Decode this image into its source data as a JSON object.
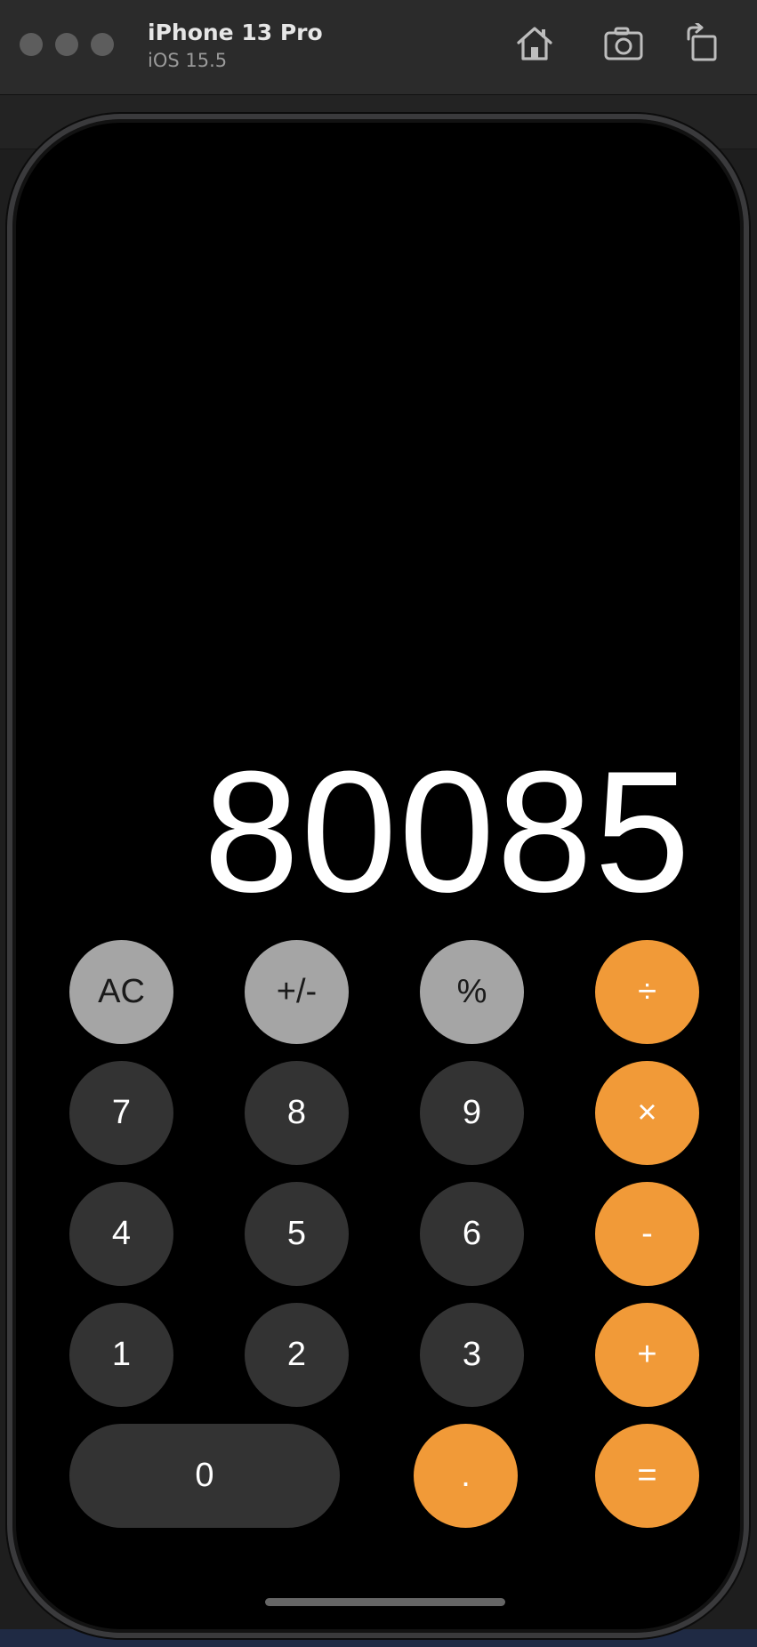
{
  "simulator": {
    "device_name": "iPhone 13 Pro",
    "os_version": "iOS 15.5"
  },
  "calculator": {
    "display": "80085",
    "rows": [
      [
        {
          "label": "AC",
          "style": "light"
        },
        {
          "label": "+/-",
          "style": "light"
        },
        {
          "label": "%",
          "style": "light"
        },
        {
          "label": "÷",
          "style": "orange"
        }
      ],
      [
        {
          "label": "7",
          "style": "dark"
        },
        {
          "label": "8",
          "style": "dark"
        },
        {
          "label": "9",
          "style": "dark"
        },
        {
          "label": "×",
          "style": "orange"
        }
      ],
      [
        {
          "label": "4",
          "style": "dark"
        },
        {
          "label": "5",
          "style": "dark"
        },
        {
          "label": "6",
          "style": "dark"
        },
        {
          "label": "-",
          "style": "orange"
        }
      ],
      [
        {
          "label": "1",
          "style": "dark"
        },
        {
          "label": "2",
          "style": "dark"
        },
        {
          "label": "3",
          "style": "dark"
        },
        {
          "label": "+",
          "style": "orange"
        }
      ],
      [
        {
          "label": "0",
          "style": "dark"
        },
        {
          "label": ".",
          "style": "orange"
        },
        {
          "label": "=",
          "style": "orange"
        }
      ]
    ]
  },
  "colors": {
    "light_key": "#a5a5a5",
    "dark_key": "#333333",
    "operator_key": "#f19a38",
    "screen": "#000000"
  },
  "icons": {
    "home": "home-icon",
    "screenshot": "camera-icon",
    "rotate": "rotate-icon"
  }
}
